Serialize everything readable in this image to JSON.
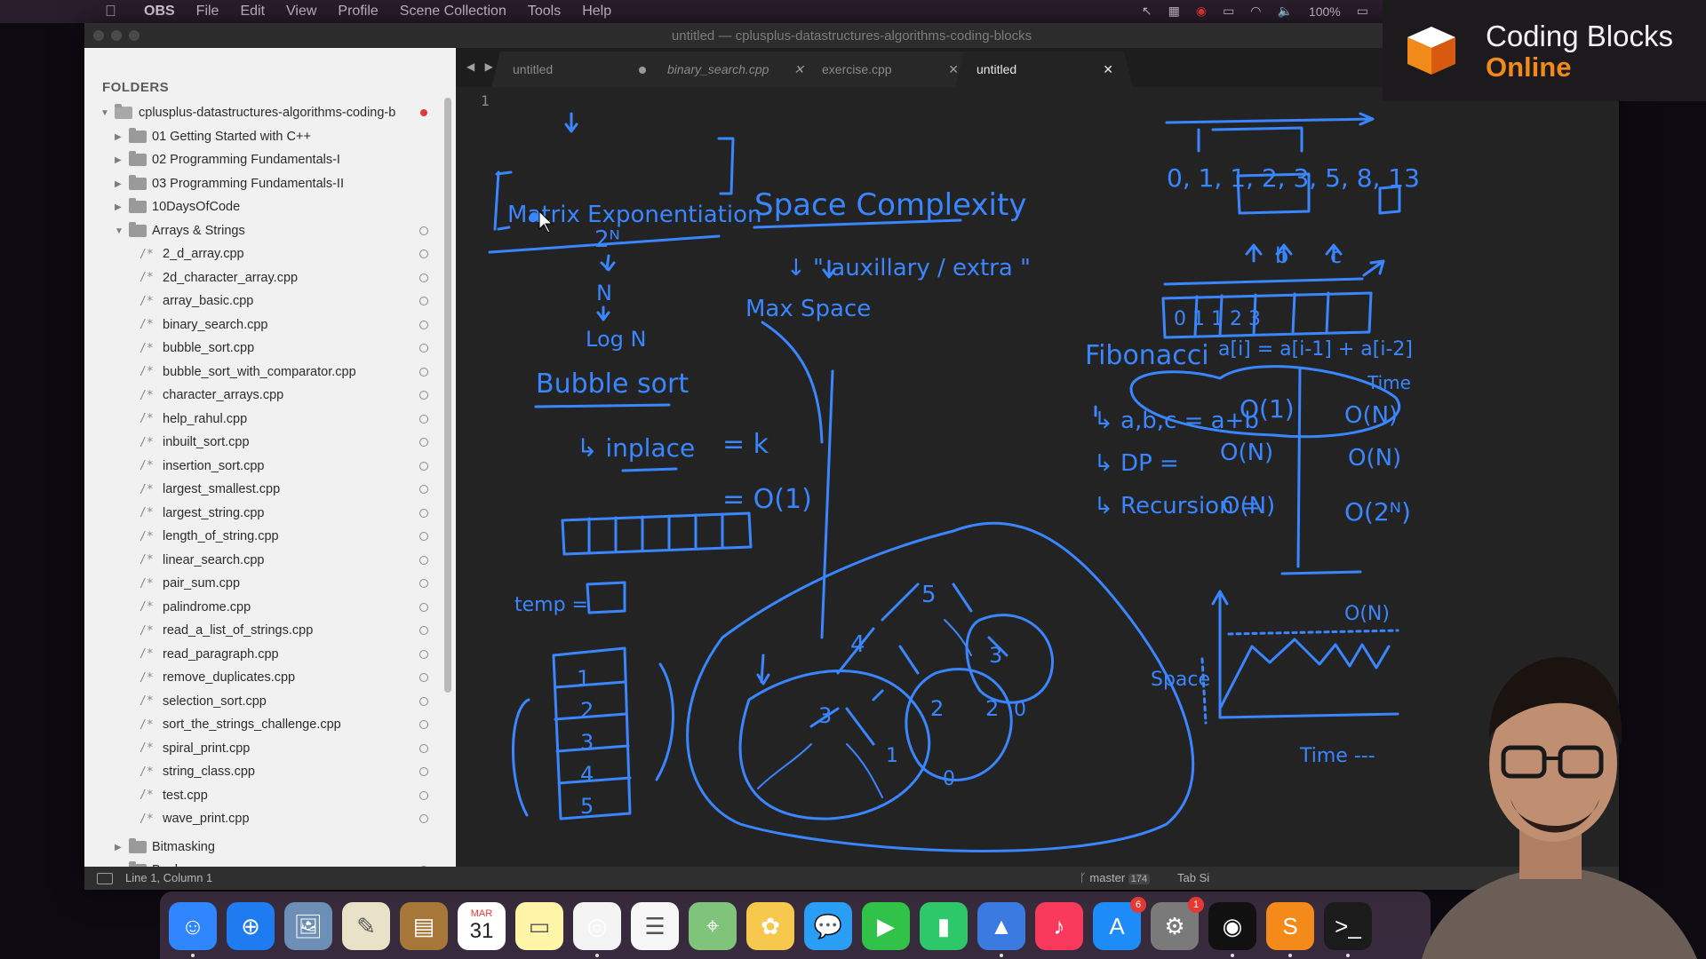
{
  "menubar": {
    "app": "OBS",
    "items": [
      "File",
      "Edit",
      "View",
      "Profile",
      "Scene Collection",
      "Tools",
      "Help"
    ],
    "battery": "100%"
  },
  "window": {
    "title": "untitled — cplusplus-datastructures-algorithms-coding-blocks"
  },
  "sidebar": {
    "header": "FOLDERS",
    "root": "cplusplus-datastructures-algorithms-coding-b",
    "folders": [
      "01 Getting Started with C++",
      "02 Programming Fundamentals-I",
      "03 Programming Fundamentals-II",
      "10DaysOfCode",
      "Arrays & Strings"
    ],
    "files": [
      "2_d_array.cpp",
      "2d_character_array.cpp",
      "array_basic.cpp",
      "binary_search.cpp",
      "bubble_sort.cpp",
      "bubble_sort_with_comparator.cpp",
      "character_arrays.cpp",
      "help_rahul.cpp",
      "inbuilt_sort.cpp",
      "insertion_sort.cpp",
      "largest_smallest.cpp",
      "largest_string.cpp",
      "length_of_string.cpp",
      "linear_search.cpp",
      "pair_sum.cpp",
      "palindrome.cpp",
      "read_a_list_of_strings.cpp",
      "read_paragraph.cpp",
      "remove_duplicates.cpp",
      "selection_sort.cpp",
      "sort_the_strings_challenge.cpp",
      "spiral_print.cpp",
      "string_class.cpp",
      "test.cpp",
      "wave_print.cpp"
    ],
    "bottom_folders": [
      "Bitmasking",
      "Book"
    ]
  },
  "tabs": [
    {
      "label": "untitled",
      "state": "dirty"
    },
    {
      "label": "binary_search.cpp",
      "state": "close"
    },
    {
      "label": "exercise.cpp",
      "state": "close"
    },
    {
      "label": "untitled",
      "state": "active"
    }
  ],
  "editor": {
    "line_number": "1"
  },
  "drawing": {
    "title_left": "Matrix Exponentiation",
    "pow": "2ᴺ",
    "n": "N",
    "logn": "Log N",
    "bubble": "Bubble sort",
    "inplace": "↳ inplace",
    "eqk": "= k",
    "eqo1": "= O(1)",
    "temp": "temp =",
    "stack": [
      "1",
      "2",
      "3",
      "4",
      "5"
    ],
    "space_title": "Space Complexity",
    "aux": "↓ \" auxillary / extra \"",
    "maxspace": "Max Space",
    "fib": "Fibonacci",
    "fib_abc": "↳ a,b,c = a+b",
    "fib_dp": "↳ DP =",
    "fib_rec": "↳ Recursion =",
    "o1": "O(1)",
    "on": "O(N)",
    "on2": "O(N)",
    "on3": "O(N)",
    "on4": "O(N)",
    "o2n": "O(2ᴺ)",
    "time_label": "Time",
    "seq": "0, 1, 1, 2, 3, 5, 8, 13",
    "b": "b",
    "c": "c",
    "arr_cells": "0 1 1 2 3",
    "recur": "a[i] = a[i-1] + a[i-2]",
    "tree": [
      "5",
      "4",
      "3",
      "3",
      "2",
      "2",
      "1",
      "0",
      "0"
    ],
    "space_axis": "Space",
    "time_axis": "Time ---",
    "peak": "O(N)"
  },
  "status": {
    "position": "Line 1, Column 1",
    "branch": "master",
    "branch_count": "174",
    "tab_size": "Tab Si"
  },
  "brand": {
    "line1": "Coding Blocks",
    "line2": "Online"
  },
  "dock": {
    "calendar_month": "MAR",
    "calendar_day": "31",
    "badges": {
      "appstore": "6",
      "prefs": "1"
    },
    "apps": [
      "finder-icon",
      "safari-icon",
      "preview-icon",
      "textedit-icon",
      "notebook-icon",
      "calendar-icon",
      "notes-icon",
      "chrome-icon",
      "reminders-icon",
      "maps-icon",
      "photos-icon",
      "messages-icon",
      "facetime-icon",
      "numbers-icon",
      "keynote-icon",
      "music-icon",
      "appstore-icon",
      "system-preferences-icon",
      "obs-icon",
      "sublime-icon",
      "terminal-icon"
    ]
  }
}
